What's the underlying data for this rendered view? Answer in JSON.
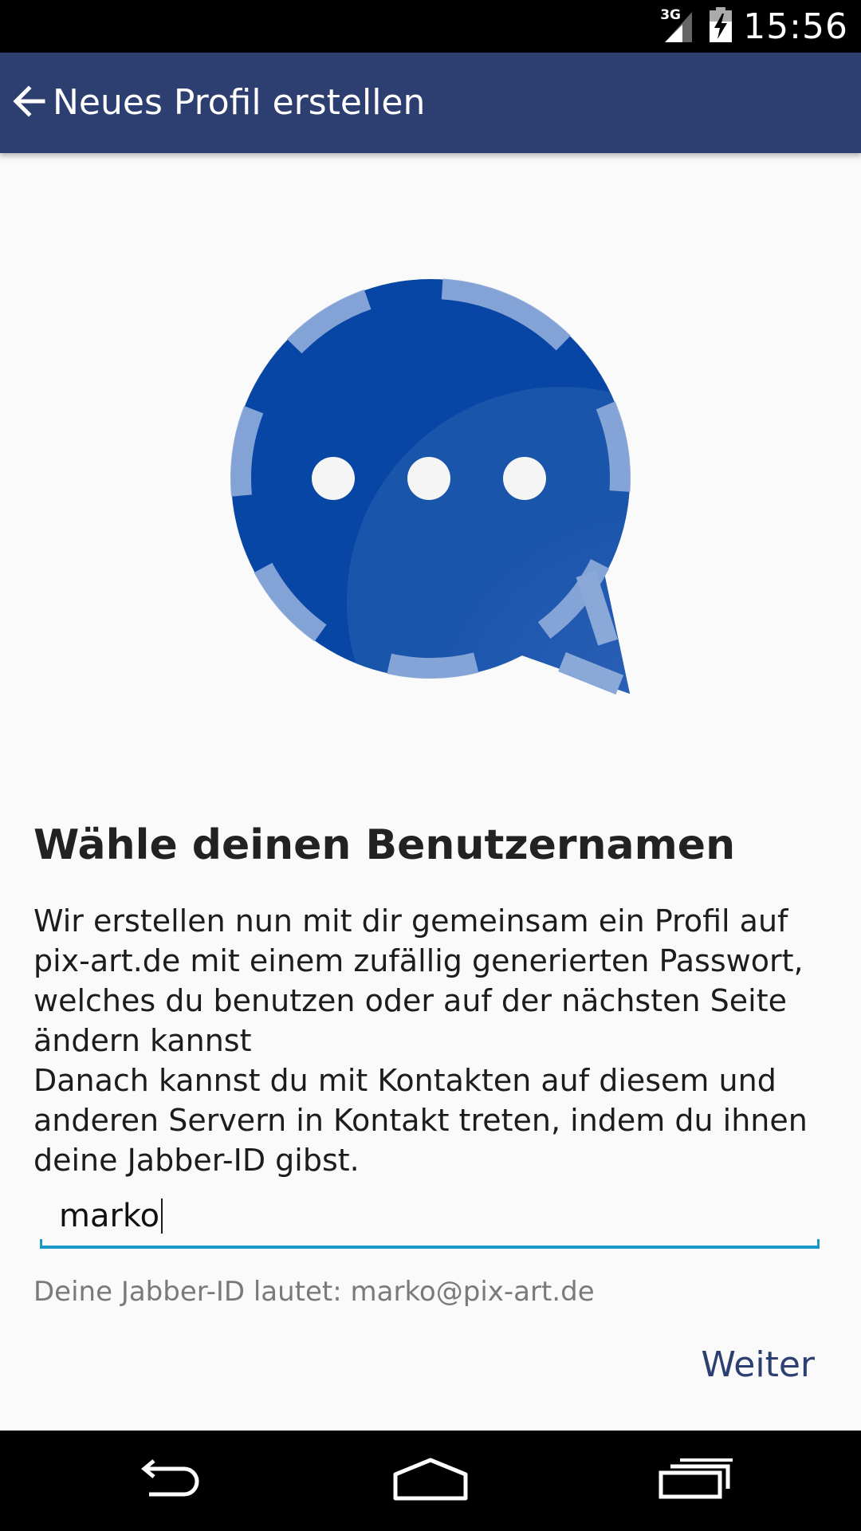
{
  "status_bar": {
    "network": "3G",
    "time": "15:56",
    "icons": [
      "signal-icon",
      "battery-charging-icon"
    ]
  },
  "app_bar": {
    "title": "Neues Profil erstellen",
    "back_icon": "arrow-back-icon"
  },
  "logo": {
    "name": "chat-bubble-logo",
    "colors": {
      "primary": "#0a47a9",
      "accent": "#8aa8d8",
      "dots": "#f5f5f5"
    }
  },
  "content": {
    "heading": "Wähle deinen Benutzernamen",
    "description": "Wir erstellen nun mit dir gemeinsam ein Profil auf pix-art.de mit einem zufällig generierten Passwort, welches du benutzen oder auf der nächsten Seite ändern kannst\nDanach kannst du mit Kontakten auf diesem und anderen Servern in Kontakt treten, indem du ihnen deine Jabber-ID gibst.",
    "username_value": "marko",
    "jid_hint": "Deine Jabber-ID lautet: marko@pix-art.de",
    "next_label": "Weiter"
  },
  "nav_bar": {
    "icons": [
      "back-icon",
      "home-icon",
      "recents-icon"
    ]
  },
  "colors": {
    "app_bar": "#2d3f70",
    "input_accent": "#1a99c7",
    "button_text": "#2d3f70"
  }
}
